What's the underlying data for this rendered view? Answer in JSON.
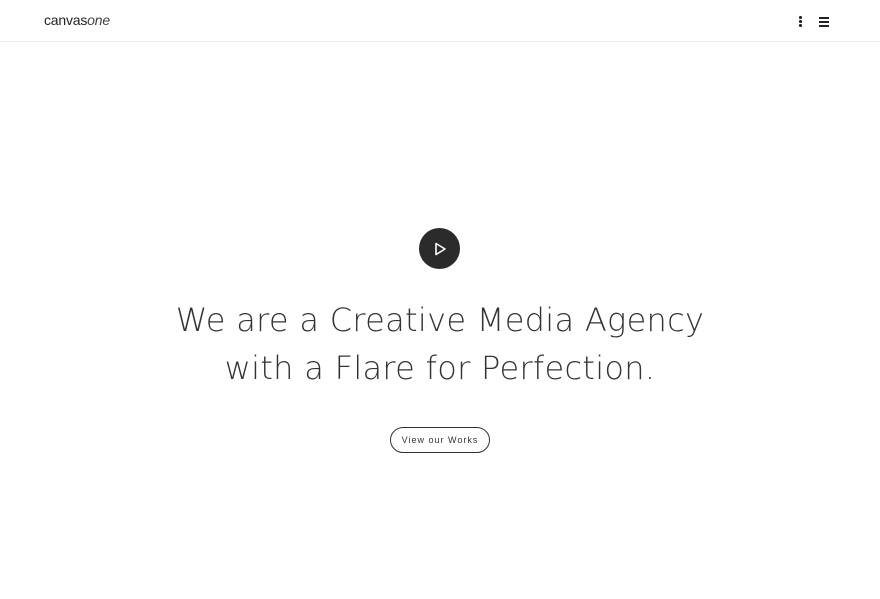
{
  "header": {
    "logo_main": "canvas",
    "logo_accent": "one",
    "more_icon": "vertical-dots-icon",
    "menu_icon": "hamburger-icon"
  },
  "hero": {
    "play_icon": "play-icon",
    "headline_line1": "We are a Creative Media Agency",
    "headline_line2": "with a Flare for Perfection.",
    "cta_label": "View our Works"
  },
  "colors": {
    "text": "#333333",
    "play_button_bg": "#2b2b2b",
    "background": "#ffffff"
  }
}
